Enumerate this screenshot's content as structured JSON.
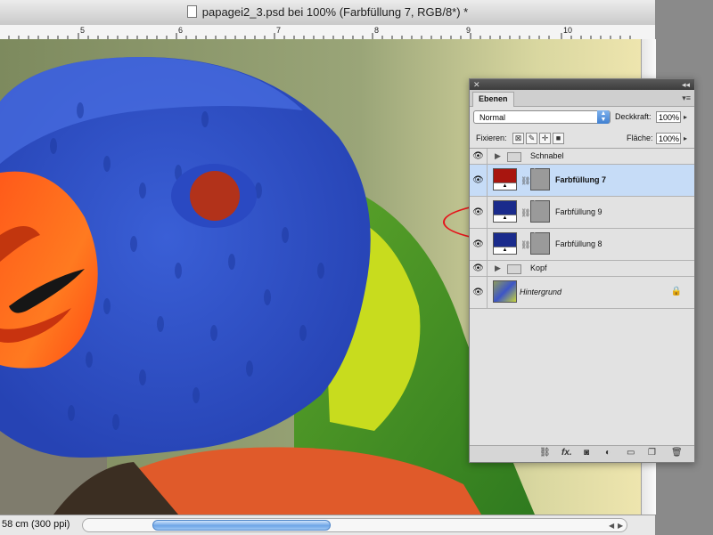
{
  "window": {
    "title": "papagei2_3.psd bei 100% (Farbfüllung 7, RGB/8*) *"
  },
  "ruler": {
    "numbers": [
      "5",
      "6",
      "7",
      "8",
      "9",
      "10"
    ]
  },
  "status": {
    "doc_size": "58 cm (300 ppi)"
  },
  "panel": {
    "tab": "Ebenen",
    "blend_mode": "Normal",
    "opacity_label": "Deckkraft:",
    "opacity_value": "100%",
    "lock_label": "Fixieren:",
    "fill_label": "Fläche:",
    "fill_value": "100%",
    "footer_fx": "fx."
  },
  "layers": [
    {
      "name": "Schnabel",
      "kind": "group",
      "visible": true
    },
    {
      "name": "Farbfüllung 7",
      "kind": "fill",
      "color": "#a8150f",
      "selected": true,
      "visible": true
    },
    {
      "name": "Farbfüllung 9",
      "kind": "fill",
      "color": "#1a2b8c",
      "visible": true
    },
    {
      "name": "Farbfüllung 8",
      "kind": "fill",
      "color": "#1a2b8c",
      "visible": true
    },
    {
      "name": "Kopf",
      "kind": "group",
      "visible": true
    },
    {
      "name": "Hintergrund",
      "kind": "background",
      "locked": true,
      "visible": true
    }
  ],
  "colors": {
    "selection": "#c6dcf7",
    "annotation": "#e5141b",
    "eye_color": "#a8150f",
    "head_blue": "#2d52cc"
  }
}
